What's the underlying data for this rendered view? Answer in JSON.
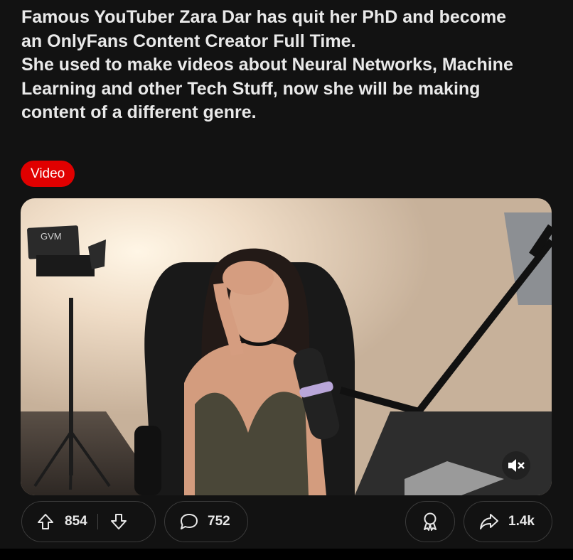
{
  "post": {
    "title_lines": [
      "Famous YouTuber Zara Dar has quit her PhD and become",
      "an OnlyFans Content Creator Full Time.",
      "She used to make videos about Neural Networks, Machine",
      "Learning and other Tech Stuff, now she will be making",
      "content of a different genre."
    ],
    "flair": "Video"
  },
  "media": {
    "light_brand": "GVM",
    "icons": {
      "mute": "speaker-mute-icon"
    }
  },
  "actions": {
    "upvotes": "854",
    "comments": "752",
    "shares": "1.4k",
    "icons": {
      "upvote": "arrow-up-icon",
      "downvote": "arrow-down-icon",
      "comment": "speech-bubble-icon",
      "award": "award-ribbon-icon",
      "share": "share-arrow-icon"
    }
  },
  "colors": {
    "background": "#121212",
    "flair": "#e00000",
    "pill_border": "#3b3b3b"
  }
}
